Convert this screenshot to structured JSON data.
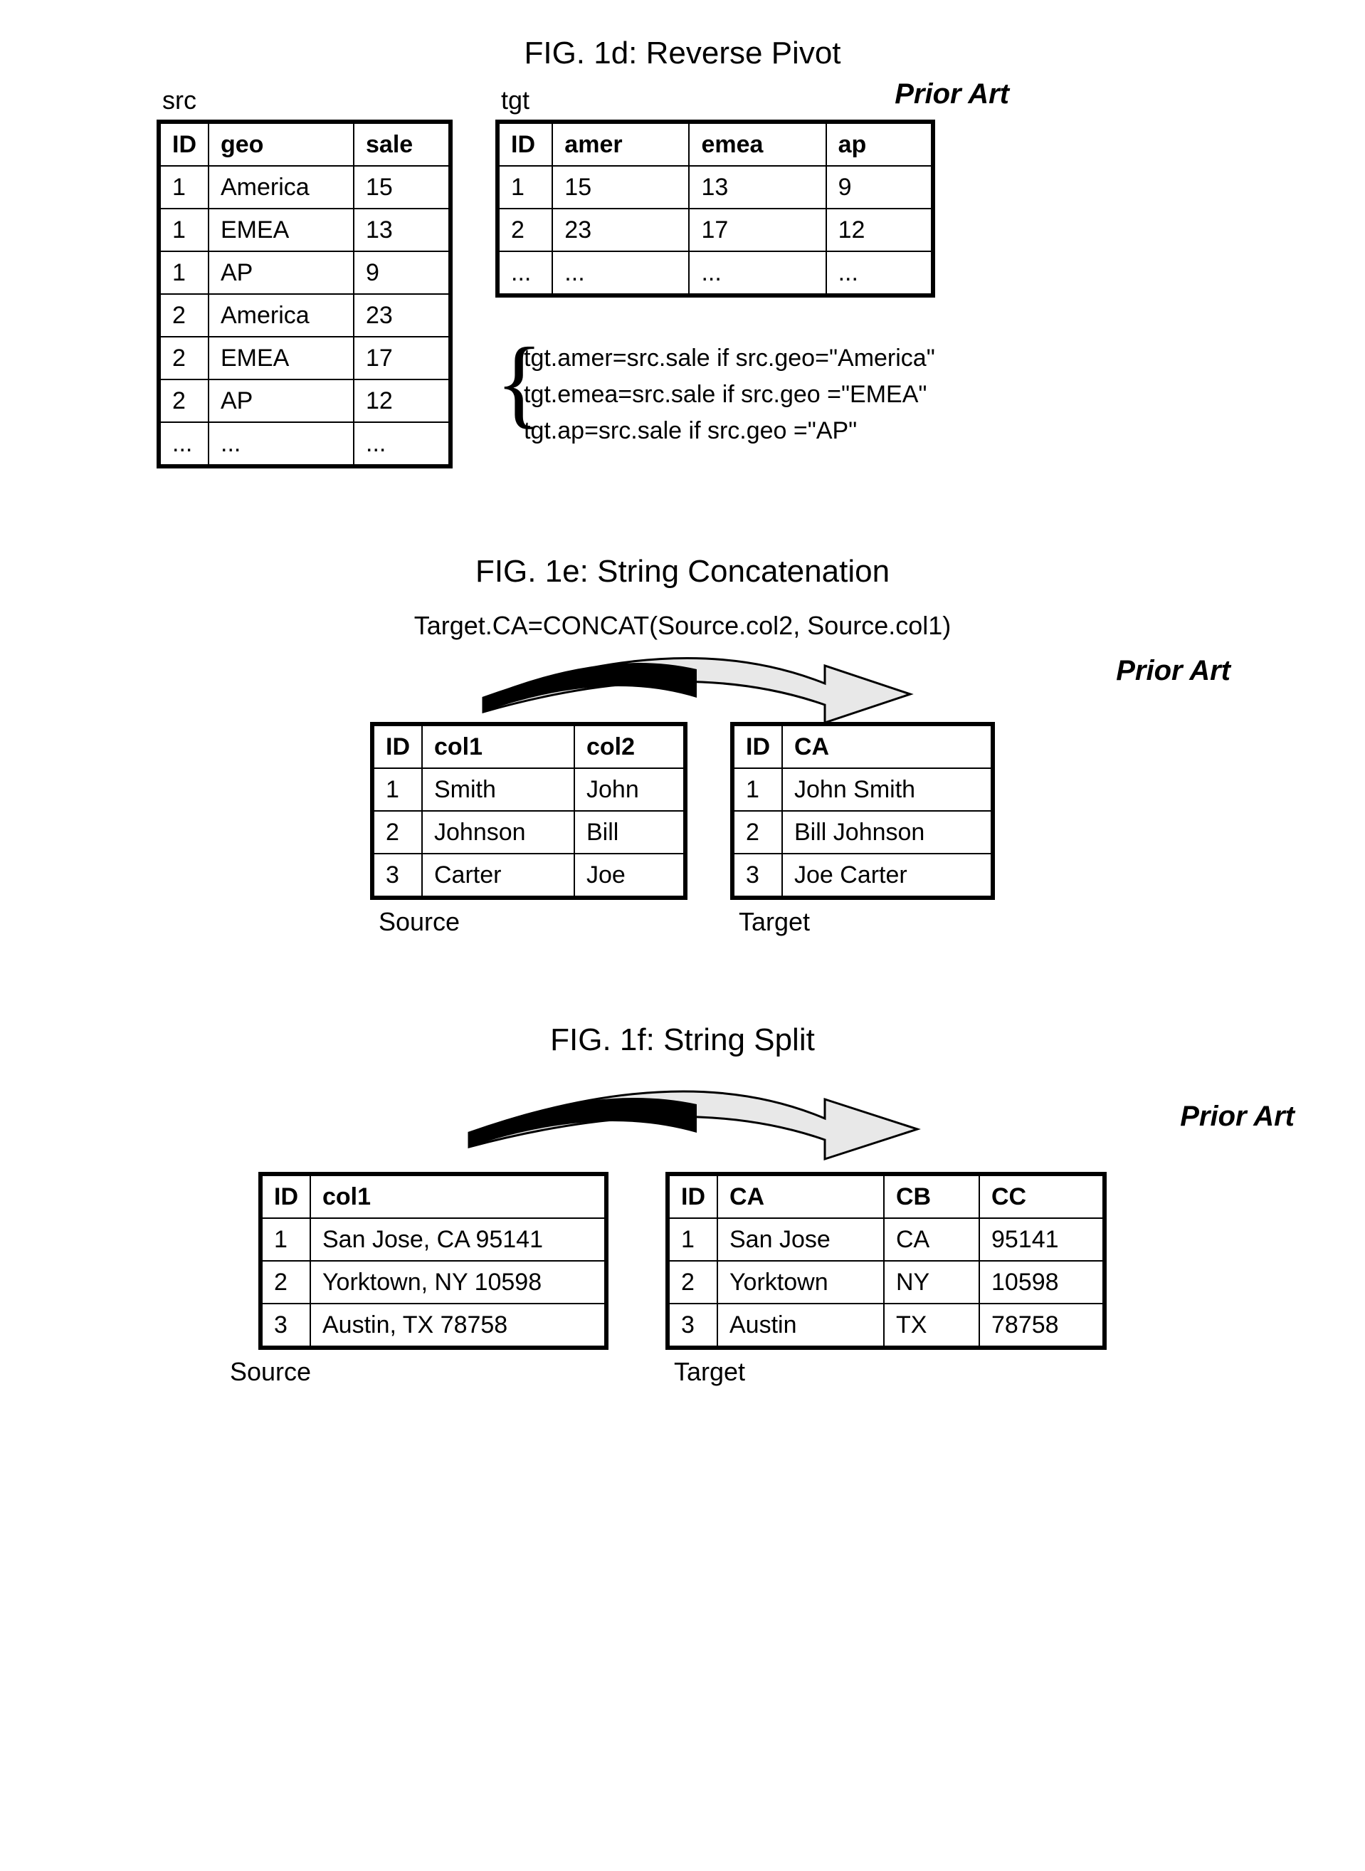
{
  "fig1d": {
    "title": "FIG. 1d: Reverse Pivot",
    "prior_art": "Prior Art",
    "src_label": "src",
    "tgt_label": "tgt",
    "src": {
      "headers": [
        "ID",
        "geo",
        "sale"
      ],
      "rows": [
        [
          "1",
          "America",
          "15"
        ],
        [
          "1",
          "EMEA",
          "13"
        ],
        [
          "1",
          "AP",
          "9"
        ],
        [
          "2",
          "America",
          "23"
        ],
        [
          "2",
          "EMEA",
          "17"
        ],
        [
          "2",
          "AP",
          "12"
        ],
        [
          "...",
          "...",
          "..."
        ]
      ]
    },
    "tgt": {
      "headers": [
        "ID",
        "amer",
        "emea",
        "ap"
      ],
      "rows": [
        [
          "1",
          "15",
          "13",
          "9"
        ],
        [
          "2",
          "23",
          "17",
          "12"
        ],
        [
          "...",
          "...",
          "...",
          "..."
        ]
      ]
    },
    "rules": [
      "tgt.amer=src.sale if src.geo=\"America\"",
      "tgt.emea=src.sale if src.geo =\"EMEA\"",
      "tgt.ap=src.sale if src.geo =\"AP\""
    ]
  },
  "fig1e": {
    "title": "FIG. 1e: String Concatenation",
    "formula": "Target.CA=CONCAT(Source.col2, Source.col1)",
    "prior_art": "Prior Art",
    "source_caption": "Source",
    "target_caption": "Target",
    "src": {
      "headers": [
        "ID",
        "col1",
        "col2"
      ],
      "rows": [
        [
          "1",
          "Smith",
          "John"
        ],
        [
          "2",
          "Johnson",
          "Bill"
        ],
        [
          "3",
          "Carter",
          "Joe"
        ]
      ]
    },
    "tgt": {
      "headers": [
        "ID",
        "CA"
      ],
      "rows": [
        [
          "1",
          "John Smith"
        ],
        [
          "2",
          "Bill Johnson"
        ],
        [
          "3",
          "Joe Carter"
        ]
      ]
    }
  },
  "fig1f": {
    "title": "FIG. 1f: String Split",
    "prior_art": "Prior Art",
    "source_caption": "Source",
    "target_caption": "Target",
    "src": {
      "headers": [
        "ID",
        "col1"
      ],
      "rows": [
        [
          "1",
          "San Jose, CA 95141"
        ],
        [
          "2",
          "Yorktown, NY 10598"
        ],
        [
          "3",
          "Austin, TX 78758"
        ]
      ]
    },
    "tgt": {
      "headers": [
        "ID",
        "CA",
        "CB",
        "CC"
      ],
      "rows": [
        [
          "1",
          "San Jose",
          "CA",
          "95141"
        ],
        [
          "2",
          "Yorktown",
          "NY",
          "10598"
        ],
        [
          "3",
          "Austin",
          "TX",
          "78758"
        ]
      ]
    }
  }
}
